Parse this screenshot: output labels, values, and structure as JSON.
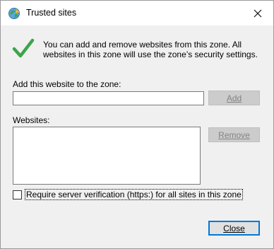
{
  "window": {
    "title": "Trusted sites",
    "close_glyph": "✕"
  },
  "info": {
    "text": "You can add and remove websites from this zone. All websites in this zone will use the zone’s security settings."
  },
  "add_section": {
    "label": "Add this website to the zone:",
    "input_value": "",
    "add_button": "Add"
  },
  "websites_section": {
    "label": "Websites:",
    "items": [],
    "remove_button": "Remove"
  },
  "https_checkbox": {
    "label": "Require server verification (https:) for all sites in this zone",
    "checked": false
  },
  "footer": {
    "close_button": "Close"
  },
  "icons": {
    "title": "internet-options-globe-icon",
    "info": "checkmark-icon",
    "close": "close-icon"
  },
  "colors": {
    "accent": "#0078d7",
    "check_green": "#3aa64a",
    "dialog_bg": "#f0f0f0",
    "disabled_button_bg": "#cccccc",
    "disabled_text": "#838383"
  }
}
